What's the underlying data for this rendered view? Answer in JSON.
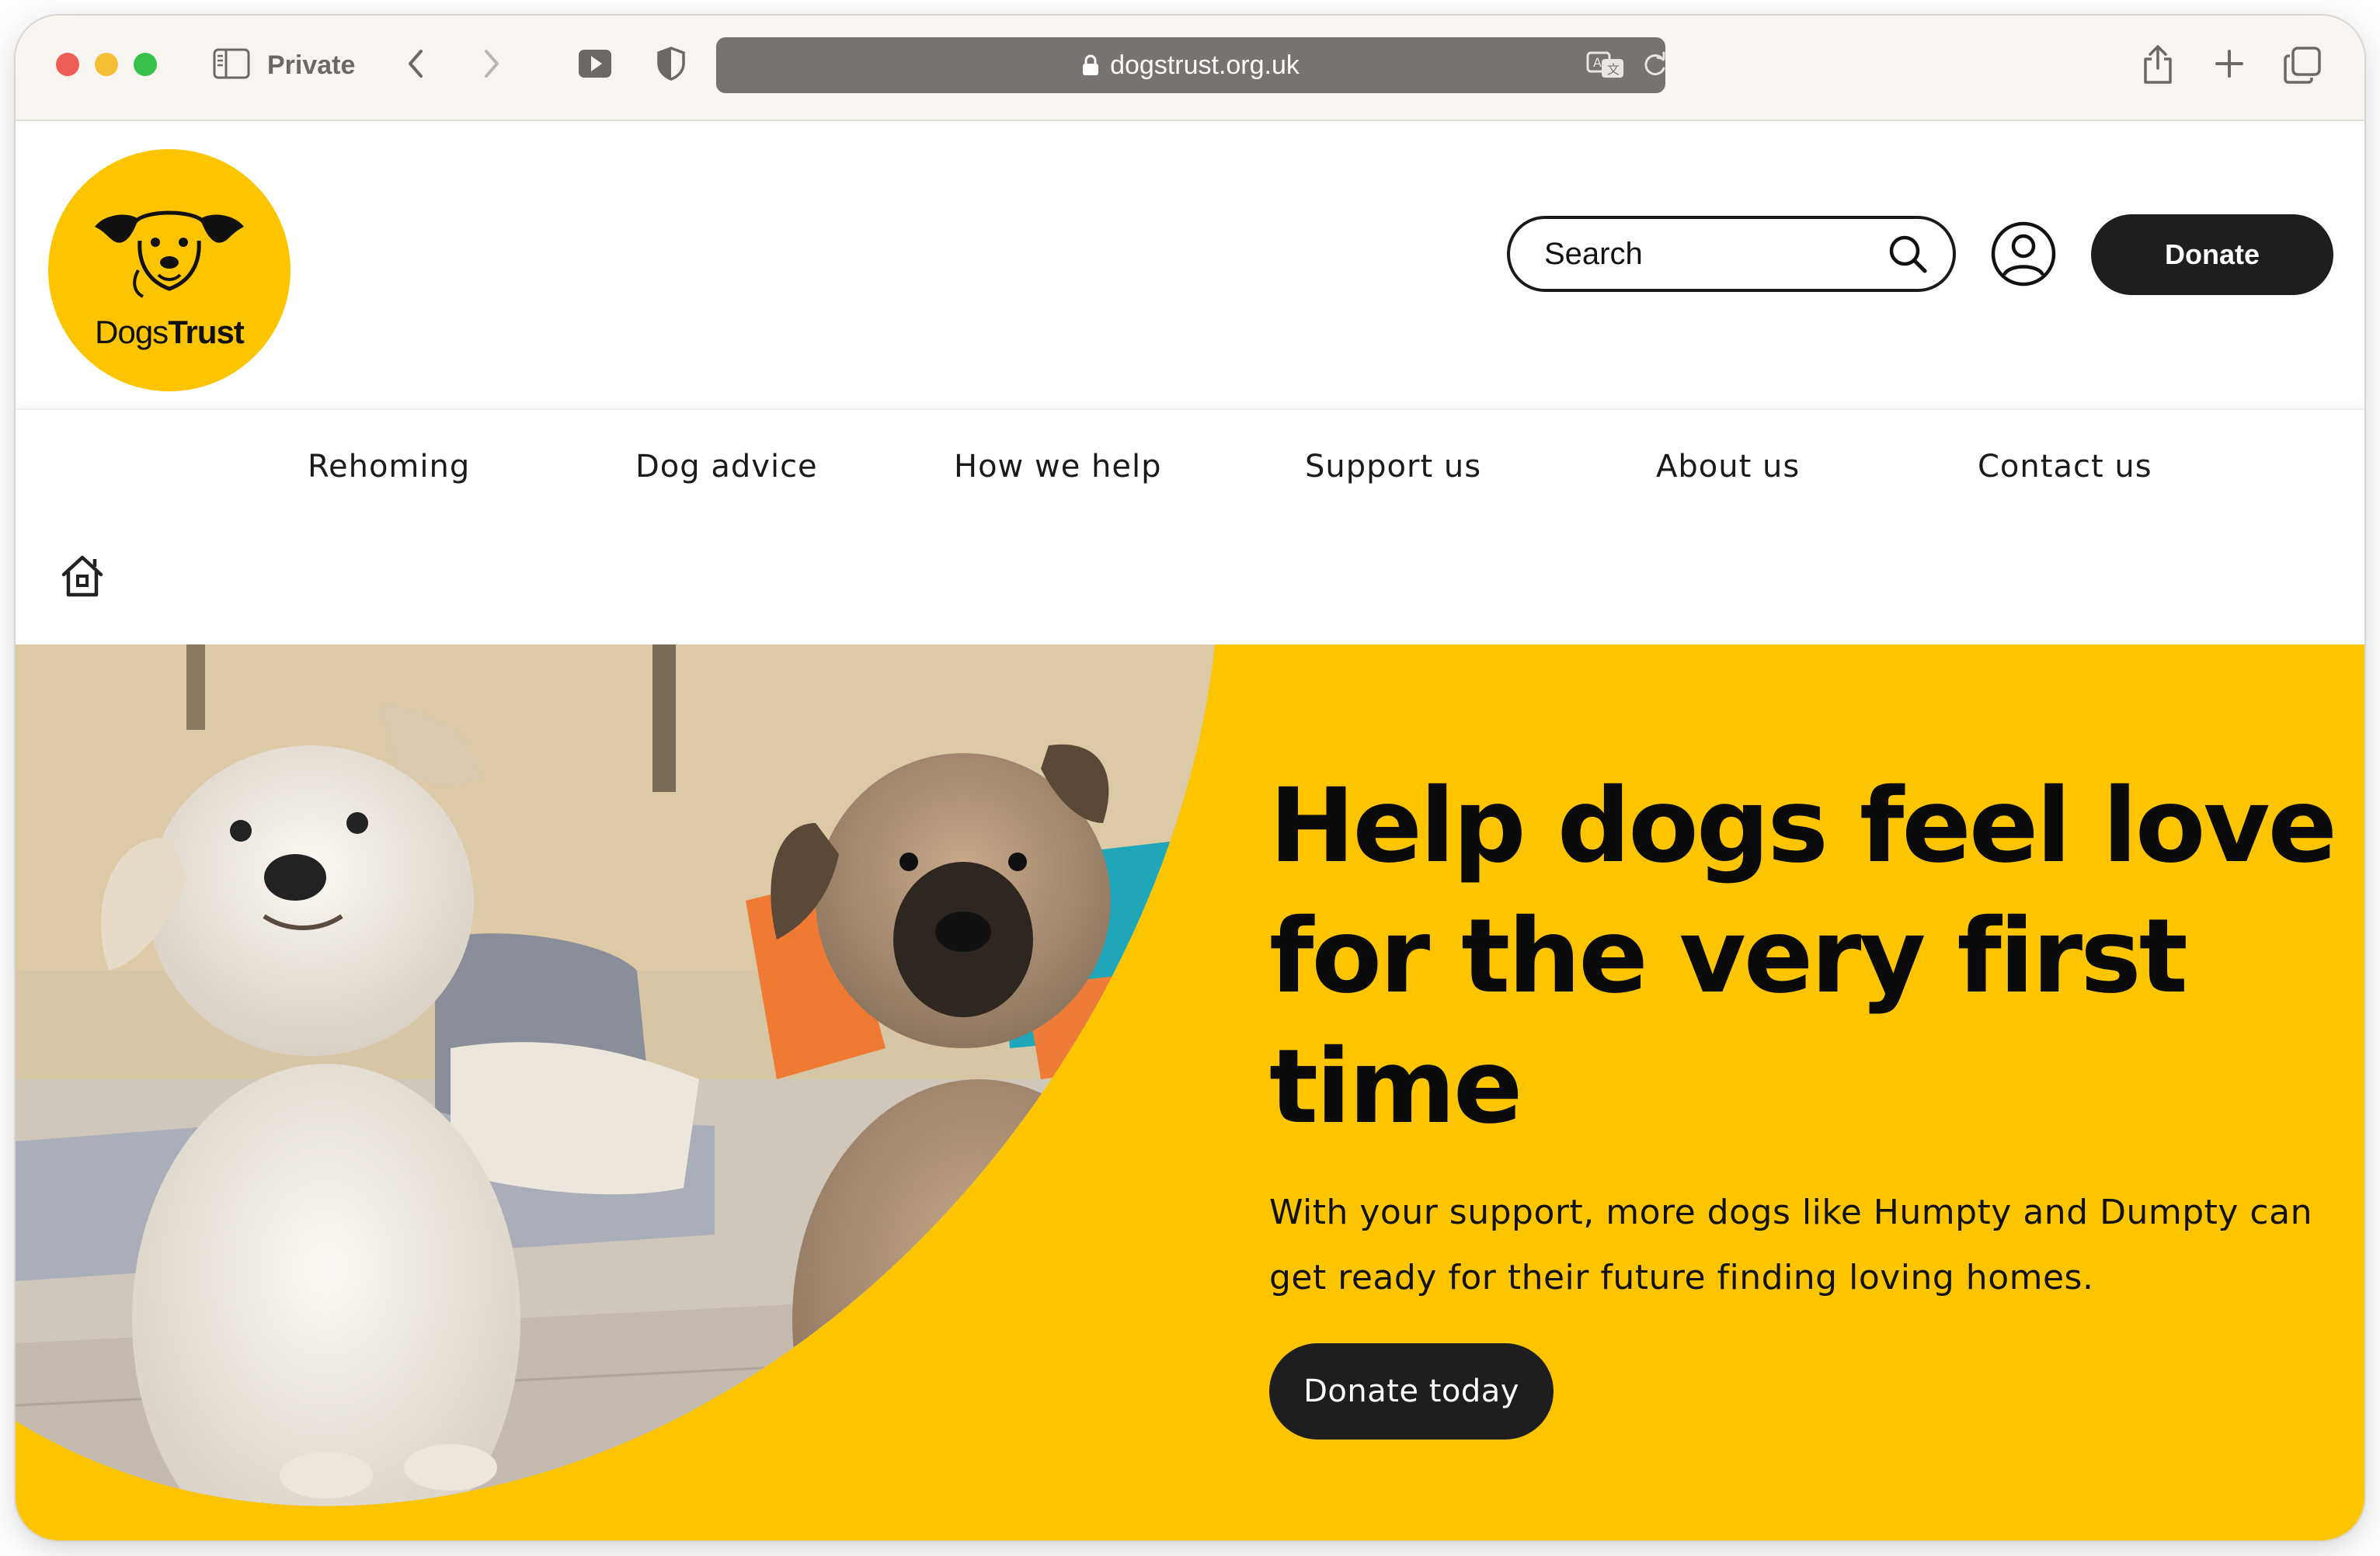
{
  "browser": {
    "private_label": "Private",
    "url": "dogstrust.org.uk"
  },
  "header": {
    "logo_text_regular": "Dogs",
    "logo_text_bold": "Trust",
    "search_placeholder": "Search",
    "donate_label": "Donate"
  },
  "nav": {
    "items": [
      {
        "label": "Rehoming"
      },
      {
        "label": "Dog advice"
      },
      {
        "label": "How we help"
      },
      {
        "label": "Support us"
      },
      {
        "label": "About us"
      },
      {
        "label": "Contact us"
      }
    ]
  },
  "hero": {
    "title": "Help dogs feel love for the very first time",
    "body": "With your support, more dogs like Humpty and Dumpty can get ready for their future finding loving homes.",
    "cta_label": "Donate today"
  },
  "colors": {
    "brand_yellow": "#fdc500",
    "button_dark": "#1e1e1e",
    "text": "#111111"
  },
  "icons": [
    "sidebar-icon",
    "back-icon",
    "forward-icon",
    "media-icon",
    "shield-icon",
    "lock-icon",
    "translate-icon",
    "reload-icon",
    "share-icon",
    "new-tab-icon",
    "tabs-overview-icon",
    "search-icon",
    "account-icon",
    "home-icon"
  ]
}
